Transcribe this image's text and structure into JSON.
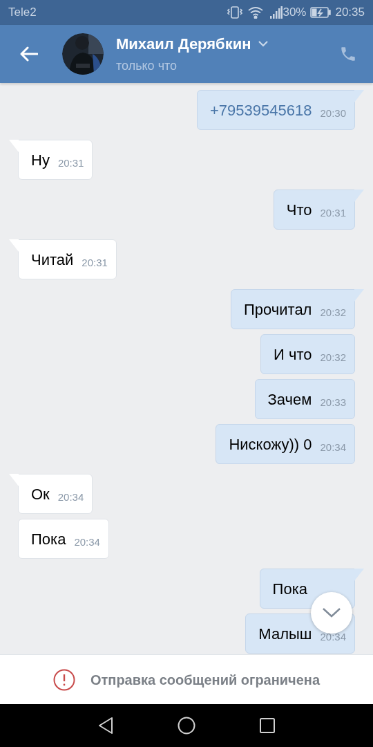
{
  "status_bar": {
    "carrier": "Tele2",
    "battery": "30%",
    "time": "20:35"
  },
  "header": {
    "name": "Михаил Дерябкин",
    "status": "только что"
  },
  "messages": [
    {
      "kind": "sent",
      "link": true,
      "text": "+79539545618",
      "time": "20:30"
    },
    {
      "kind": "received",
      "link": false,
      "text": "Ну",
      "time": "20:31"
    },
    {
      "kind": "sent",
      "link": false,
      "text": "Что",
      "time": "20:31"
    },
    {
      "kind": "received",
      "link": false,
      "text": "Читай",
      "time": "20:31"
    },
    {
      "kind": "sent",
      "link": false,
      "text": "Прочитал",
      "time": "20:32"
    },
    {
      "kind": "sent",
      "link": false,
      "text": "И что",
      "time": "20:32"
    },
    {
      "kind": "sent",
      "link": false,
      "text": "Зачем",
      "time": "20:33"
    },
    {
      "kind": "sent",
      "link": false,
      "text": "Нискожу)) 0",
      "time": "20:34"
    },
    {
      "kind": "received",
      "link": false,
      "text": "Ок",
      "time": "20:34"
    },
    {
      "kind": "received",
      "link": false,
      "text": "Пока",
      "time": "20:34"
    },
    {
      "kind": "sent",
      "link": false,
      "text": "Пока"
    },
    {
      "kind": "sent",
      "link": false,
      "text": "Малыш",
      "time": "20:34"
    }
  ],
  "notice": "Отправка сообщений ограничена"
}
